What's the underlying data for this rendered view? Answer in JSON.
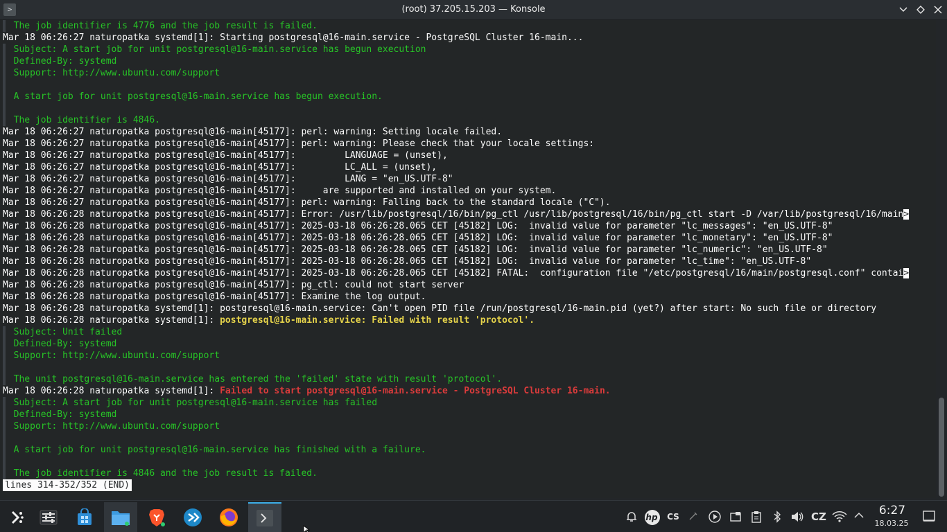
{
  "window": {
    "title": "(root) 37.205.15.203 — Konsole"
  },
  "terminal": {
    "lines": [
      {
        "style": "green",
        "text": "  The job identifier is 4776 and the job result is failed."
      },
      {
        "style": "plain",
        "text": "Mar 18 06:26:27 naturopatka systemd[1]: Starting postgresql@16-main.service - PostgreSQL Cluster 16-main..."
      },
      {
        "style": "green",
        "text": "  Subject: A start job for unit postgresql@16-main.service has begun execution"
      },
      {
        "style": "green",
        "text": "  Defined-By: systemd"
      },
      {
        "style": "green",
        "text": "  Support: http://www.ubuntu.com/support"
      },
      {
        "style": "green",
        "text": "  "
      },
      {
        "style": "green",
        "text": "  A start job for unit postgresql@16-main.service has begun execution."
      },
      {
        "style": "green",
        "text": "  "
      },
      {
        "style": "green",
        "text": "  The job identifier is 4846."
      },
      {
        "style": "plain",
        "text": "Mar 18 06:26:27 naturopatka postgresql@16-main[45177]: perl: warning: Setting locale failed."
      },
      {
        "style": "plain",
        "text": "Mar 18 06:26:27 naturopatka postgresql@16-main[45177]: perl: warning: Please check that your locale settings:"
      },
      {
        "style": "plain",
        "text": "Mar 18 06:26:27 naturopatka postgresql@16-main[45177]:         LANGUAGE = (unset),"
      },
      {
        "style": "plain",
        "text": "Mar 18 06:26:27 naturopatka postgresql@16-main[45177]:         LC_ALL = (unset),"
      },
      {
        "style": "plain",
        "text": "Mar 18 06:26:27 naturopatka postgresql@16-main[45177]:         LANG = \"en_US.UTF-8\""
      },
      {
        "style": "plain",
        "text": "Mar 18 06:26:27 naturopatka postgresql@16-main[45177]:     are supported and installed on your system."
      },
      {
        "style": "plain",
        "text": "Mar 18 06:26:27 naturopatka postgresql@16-main[45177]: perl: warning: Falling back to the standard locale (\"C\")."
      },
      {
        "style": "plain",
        "text": "Mar 18 06:26:28 naturopatka postgresql@16-main[45177]: Error: /usr/lib/postgresql/16/bin/pg_ctl /usr/lib/postgresql/16/bin/pg_ctl start -D /var/lib/postgresql/16/main",
        "trunc": ">"
      },
      {
        "style": "plain",
        "text": "Mar 18 06:26:28 naturopatka postgresql@16-main[45177]: 2025-03-18 06:26:28.065 CET [45182] LOG:  invalid value for parameter \"lc_messages\": \"en_US.UTF-8\""
      },
      {
        "style": "plain",
        "text": "Mar 18 06:26:28 naturopatka postgresql@16-main[45177]: 2025-03-18 06:26:28.065 CET [45182] LOG:  invalid value for parameter \"lc_monetary\": \"en_US.UTF-8\""
      },
      {
        "style": "plain",
        "text": "Mar 18 06:26:28 naturopatka postgresql@16-main[45177]: 2025-03-18 06:26:28.065 CET [45182] LOG:  invalid value for parameter \"lc_numeric\": \"en_US.UTF-8\""
      },
      {
        "style": "plain",
        "text": "Mar 18 06:26:28 naturopatka postgresql@16-main[45177]: 2025-03-18 06:26:28.065 CET [45182] LOG:  invalid value for parameter \"lc_time\": \"en_US.UTF-8\""
      },
      {
        "style": "plain",
        "text": "Mar 18 06:26:28 naturopatka postgresql@16-main[45177]: 2025-03-18 06:26:28.065 CET [45182] FATAL:  configuration file \"/etc/postgresql/16/main/postgresql.conf\" contai",
        "trunc": ">"
      },
      {
        "style": "plain",
        "text": "Mar 18 06:26:28 naturopatka postgresql@16-main[45177]: pg_ctl: could not start server"
      },
      {
        "style": "plain",
        "text": "Mar 18 06:26:28 naturopatka postgresql@16-main[45177]: Examine the log output."
      },
      {
        "style": "plain",
        "text": "Mar 18 06:26:28 naturopatka systemd[1]: postgresql@16-main.service: Can't open PID file /run/postgresql/16-main.pid (yet?) after start: No such file or directory"
      },
      {
        "style": "plain",
        "text": "Mar 18 06:26:28 naturopatka systemd[1]: ",
        "hl": "postgresql@16-main.service: Failed with result 'protocol'.",
        "hlclass": "hl-y"
      },
      {
        "style": "green",
        "text": "  Subject: Unit failed"
      },
      {
        "style": "green",
        "text": "  Defined-By: systemd"
      },
      {
        "style": "green",
        "text": "  Support: http://www.ubuntu.com/support"
      },
      {
        "style": "green",
        "text": "  "
      },
      {
        "style": "green",
        "text": "  The unit postgresql@16-main.service has entered the 'failed' state with result 'protocol'."
      },
      {
        "style": "plain",
        "text": "Mar 18 06:26:28 naturopatka systemd[1]: ",
        "hl": "Failed to start postgresql@16-main.service - PostgreSQL Cluster 16-main.",
        "hlclass": "hl-r"
      },
      {
        "style": "green",
        "text": "  Subject: A start job for unit postgresql@16-main.service has failed"
      },
      {
        "style": "green",
        "text": "  Defined-By: systemd"
      },
      {
        "style": "green",
        "text": "  Support: http://www.ubuntu.com/support"
      },
      {
        "style": "green",
        "text": "  "
      },
      {
        "style": "green",
        "text": "  A start job for unit postgresql@16-main.service has finished with a failure."
      },
      {
        "style": "green",
        "text": "  "
      },
      {
        "style": "green",
        "text": "  The job identifier is 4846 and the job result is failed."
      }
    ],
    "pager_status": "lines 314-352/352 (END)"
  },
  "taskbar": {
    "apps": [
      {
        "name": "application-launcher",
        "icon": "kde-launcher-icon"
      },
      {
        "name": "system-settings",
        "icon": "sliders-icon"
      },
      {
        "name": "discover",
        "icon": "store-bag-icon"
      },
      {
        "name": "dolphin",
        "icon": "folder-icon"
      },
      {
        "name": "brave",
        "icon": "brave-lion-icon"
      },
      {
        "name": "kdeconnect",
        "icon": "kdeconnect-icon"
      },
      {
        "name": "firefox",
        "icon": "firefox-icon"
      },
      {
        "name": "konsole",
        "icon": "terminal-icon"
      }
    ],
    "tray": {
      "hp_label": "hp",
      "cs_label": "CS",
      "keyboard_layout": "CZ",
      "time": "6:27",
      "date": "18.03.25"
    }
  },
  "colors": {
    "terminal_bg": "#232627",
    "green_text": "#27c427",
    "warning_yellow": "#e5d34b",
    "error_red": "#da3b3b",
    "accent_blue": "#3daee9"
  }
}
